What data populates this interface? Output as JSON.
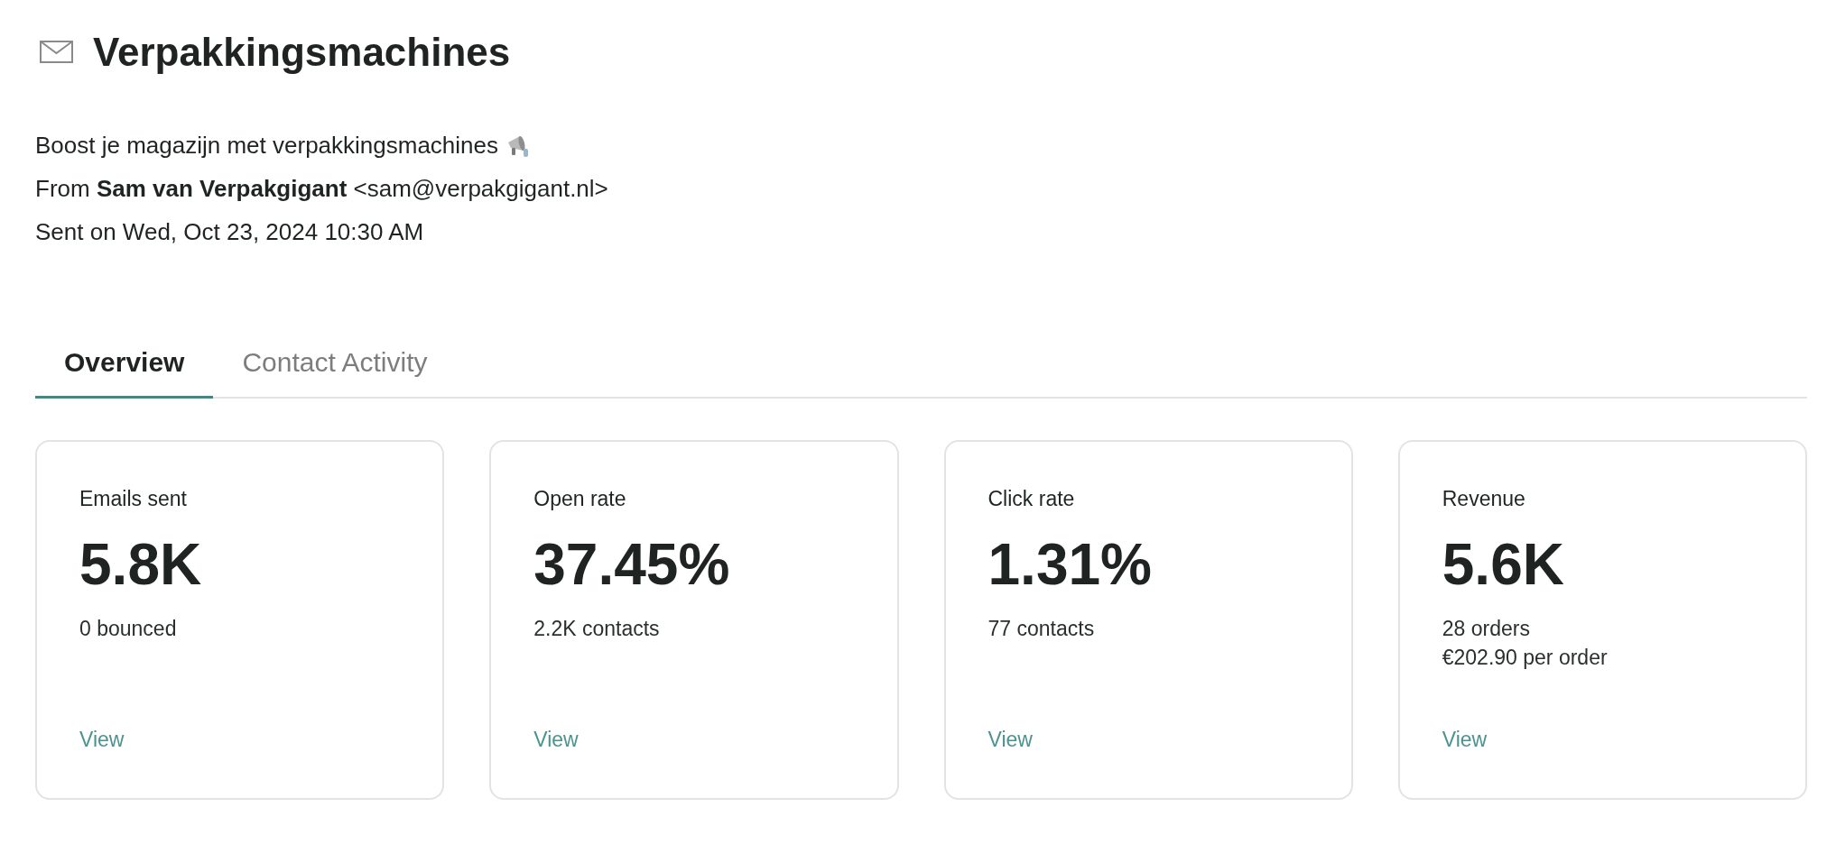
{
  "header": {
    "title": "Verpakkingsmachines"
  },
  "message": {
    "subject": "Boost je magazijn met verpakkingsmachines",
    "from": "From **Sam van Verpakgigant** <sam@verpakgigant.nl>",
    "sent": "Sent on Wed, Oct 23, 2024 10:30 AM"
  },
  "tabs": [
    {
      "label": "Overview",
      "selected": true
    },
    {
      "label": "Contact Activity",
      "selected": false
    }
  ],
  "cards": [
    {
      "label": "Emails sent",
      "value": "5.8K",
      "details": [
        "0 bounced"
      ],
      "link": "View"
    },
    {
      "label": "Open rate",
      "value": "37.45%",
      "details": [
        "2.2K contacts"
      ],
      "link": "View"
    },
    {
      "label": "Click rate",
      "value": "1.31%",
      "details": [
        "77 contacts"
      ],
      "link": "View"
    },
    {
      "label": "Revenue",
      "value": "5.6K",
      "details": [
        "28 orders",
        "€202.90 per order"
      ],
      "link": "View"
    }
  ]
}
